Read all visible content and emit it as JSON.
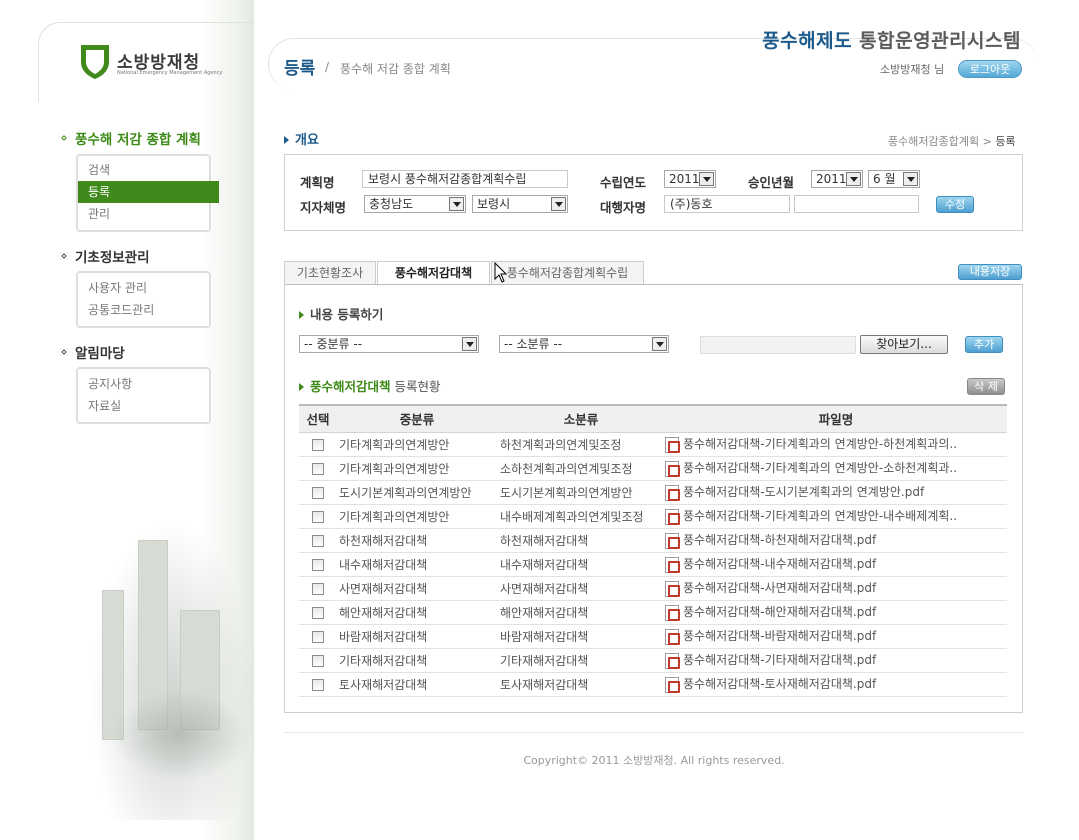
{
  "org": {
    "logo_name": "소방방재청",
    "logo_sub": "National Emergency Management Agency"
  },
  "system": {
    "title_highlight": "풍수해제도",
    "title_rest": " 통합운영관리시스템",
    "user": "소방방재청 님",
    "logout": "로그아웃"
  },
  "page": {
    "title": "등록",
    "sep": "/",
    "subtitle": "풍수해 저감 종합 계획"
  },
  "sidebar": {
    "groups": [
      {
        "title": "풍수해 저감 종합 계획",
        "items": [
          "검색",
          "등록",
          "관리"
        ],
        "selected": 1
      },
      {
        "title": "기초정보관리",
        "items": [
          "사용자 관리",
          "공통코드관리"
        ]
      },
      {
        "title": "알림마당",
        "items": [
          "공지사항",
          "자료실"
        ]
      }
    ]
  },
  "overview": {
    "heading": "개요",
    "crumb_parent": "풍수해저감종합계획",
    "crumb_sep": ">",
    "crumb_current": "등록",
    "plan_label": "계획명",
    "plan_value": "보령시 풍수해저감종합계획수립",
    "year_label": "수립연도",
    "year_value": "2011",
    "approval_label": "승인년월",
    "approval_year": "2011",
    "approval_month": "6 월",
    "region_label": "지자체명",
    "province": "충청남도",
    "city": "보령시",
    "agency_label": "대행자명",
    "agency_value": "(주)동호",
    "agency_value2": "",
    "edit_btn": "수정"
  },
  "tabs": [
    "기초현황조사",
    "풍수해저감대책",
    "풍수해저감종합계획수립"
  ],
  "active_tab": 1,
  "save_btn": "내용저장",
  "register": {
    "heading": "내용 등록하기",
    "mid_select": "-- 중분류 --",
    "sub_select": "-- 소분류 --",
    "file_value": "",
    "browse_btn": "찾아보기...",
    "add_btn": "추가"
  },
  "list": {
    "heading_em": "풍수해저감대책",
    "heading_rest": " 등록현황",
    "delete_btn": "삭 제",
    "columns": [
      "선택",
      "중분류",
      "소분류",
      "파일명"
    ],
    "rows": [
      [
        "기타계획과의연계방안",
        "하천계획과의연계및조정",
        "풍수해저감대책-기타계획과의 연계방안-하천계획과의.."
      ],
      [
        "기타계획과의연계방안",
        "소하천계획과의연계및조정",
        "풍수해저감대책-기타계획과의 연계방안-소하천계획과.."
      ],
      [
        "도시기본계획과의연계방안",
        "도시기본계획과의연계방안",
        "풍수해저감대책-도시기본계획과의 연계방안.pdf"
      ],
      [
        "기타계획과의연계방안",
        "내수배제계획과의연계및조정",
        "풍수해저감대책-기타계획과의 연계방안-내수배제계획.."
      ],
      [
        "하천재해저감대책",
        "하천재해저감대책",
        "풍수해저감대책-하천재해저감대책.pdf"
      ],
      [
        "내수재해저감대책",
        "내수재해저감대책",
        "풍수해저감대책-내수재해저감대책.pdf"
      ],
      [
        "사면재해저감대책",
        "사면재해저감대책",
        "풍수해저감대책-사면재해저감대책.pdf"
      ],
      [
        "해안재해저감대책",
        "해안재해저감대책",
        "풍수해저감대책-해안재해저감대책.pdf"
      ],
      [
        "바람재해저감대책",
        "바람재해저감대책",
        "풍수해저감대책-바람재해저감대책.pdf"
      ],
      [
        "기타재해저감대책",
        "기타재해저감대책",
        "풍수해저감대책-기타재해저감대책.pdf"
      ],
      [
        "토사재해저감대책",
        "토사재해저감대책",
        "풍수해저감대책-토사재해저감대책.pdf"
      ]
    ]
  },
  "footer": {
    "copyright": "Copyright© 2011 소방방재청. All rights reserved."
  },
  "colors": {
    "brand_green": "#3f8a1b",
    "brand_blue": "#1d5b8d"
  }
}
